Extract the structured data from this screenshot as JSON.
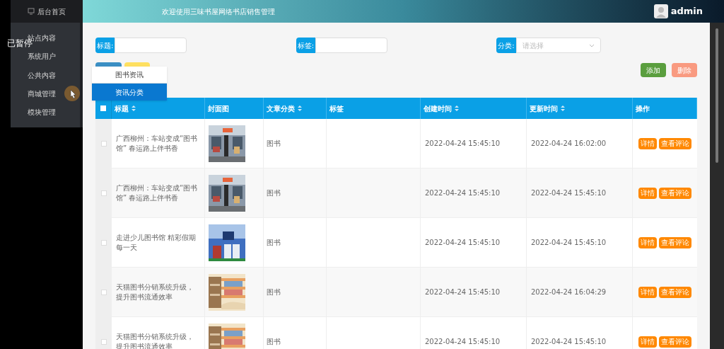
{
  "overlay": {
    "text": "已暂停"
  },
  "sidebar": {
    "home": "后台首页",
    "items": [
      {
        "label": "站点内容",
        "pointer": false
      },
      {
        "label": "系统用户",
        "pointer": false
      },
      {
        "label": "公共内容",
        "pointer": false
      },
      {
        "label": "商城管理",
        "pointer": true
      },
      {
        "label": "模块管理",
        "pointer": false
      }
    ]
  },
  "header": {
    "title": "欢迎使用三味书屋网络书店销售管理",
    "user": "admin"
  },
  "dropdown": [
    {
      "label": "图书资讯",
      "selected": false
    },
    {
      "label": "资讯分类",
      "selected": true
    }
  ],
  "filters": [
    {
      "kind": "input",
      "label": "标题:"
    },
    {
      "kind": "input",
      "label": "标签:"
    },
    {
      "kind": "select",
      "label": "分类:",
      "placeholder": "请选择"
    }
  ],
  "actions": {
    "add": "添加",
    "delete": "删除"
  },
  "table": {
    "select_all": {
      "checked": false
    },
    "columns": [
      {
        "label": "标题",
        "sortable": true
      },
      {
        "label": "封面图",
        "sortable": false
      },
      {
        "label": "文章分类",
        "sortable": true
      },
      {
        "label": "标签",
        "sortable": false
      },
      {
        "label": "创建时间",
        "sortable": true
      },
      {
        "label": "更新时间",
        "sortable": true
      },
      {
        "label": "操作",
        "sortable": false
      }
    ],
    "rows": [
      {
        "checked": false,
        "title": "广西柳州：车站变成“图书馆” 春运路上伴书香",
        "category": "图书",
        "created": "2022-04-24 15:45:10",
        "updated": "2022-04-24 16:02:00",
        "buttons": [
          "详情",
          "查看评论"
        ]
      },
      {
        "checked": false,
        "title": "广西柳州：车站变成“图书馆” 春运路上伴书香",
        "category": "图书",
        "created": "2022-04-24 15:45:10",
        "updated": "2022-04-24 15:45:10",
        "buttons": [
          "详情",
          "查看评论"
        ]
      },
      {
        "checked": false,
        "title": "走进少儿图书馆 精彩假期每一天",
        "category": "图书",
        "created": "2022-04-24 15:45:10",
        "updated": "2022-04-24 15:45:10",
        "buttons": [
          "详情",
          "查看评论"
        ]
      },
      {
        "checked": false,
        "title": "天猫图书分销系统升级，提升图书流通效率",
        "category": "图书",
        "created": "2022-04-24 15:45:10",
        "updated": "2022-04-24 16:04:29",
        "buttons": [
          "详情",
          "查看评论"
        ]
      },
      {
        "checked": false,
        "title": "天猫图书分销系统升级，提升图书流通效率",
        "category": "图书",
        "created": "2022-04-24 15:45:10",
        "updated": "2022-04-24 15:45:10",
        "buttons": [
          "详情",
          "查看评论"
        ]
      }
    ]
  }
}
